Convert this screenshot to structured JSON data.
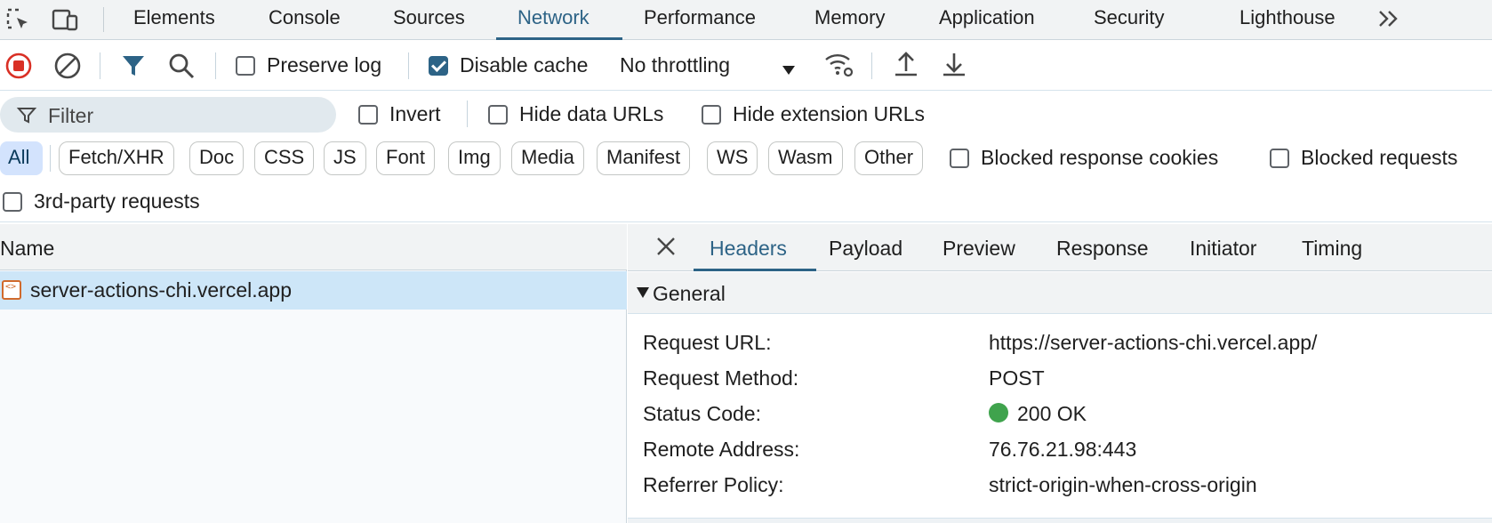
{
  "tabs": [
    {
      "label": "Elements",
      "active": false
    },
    {
      "label": "Console",
      "active": false
    },
    {
      "label": "Sources",
      "active": false
    },
    {
      "label": "Network",
      "active": true
    },
    {
      "label": "Performance",
      "active": false
    },
    {
      "label": "Memory",
      "active": false
    },
    {
      "label": "Application",
      "active": false
    },
    {
      "label": "Security",
      "active": false
    },
    {
      "label": "Lighthouse",
      "active": false
    }
  ],
  "toolbar": {
    "preserve_log": "Preserve log",
    "disable_cache": "Disable cache",
    "throttling": "No throttling"
  },
  "filter": {
    "placeholder": "Filter",
    "invert": "Invert",
    "hide_data_urls": "Hide data URLs",
    "hide_extension_urls": "Hide extension URLs"
  },
  "types": [
    "All",
    "Fetch/XHR",
    "Doc",
    "CSS",
    "JS",
    "Font",
    "Img",
    "Media",
    "Manifest",
    "WS",
    "Wasm",
    "Other"
  ],
  "extra_filters": {
    "blocked_cookies": "Blocked response cookies",
    "blocked_requests": "Blocked requests",
    "third_party": "3rd-party requests"
  },
  "requests": {
    "column_name": "Name",
    "rows": [
      {
        "name": "server-actions-chi.vercel.app"
      }
    ]
  },
  "details": {
    "tabs": [
      "Headers",
      "Payload",
      "Preview",
      "Response",
      "Initiator",
      "Timing"
    ],
    "section_title": "General",
    "general": [
      {
        "key": "Request URL:",
        "value": "https://server-actions-chi.vercel.app/"
      },
      {
        "key": "Request Method:",
        "value": "POST"
      },
      {
        "key": "Status Code:",
        "value": "200 OK"
      },
      {
        "key": "Remote Address:",
        "value": "76.76.21.98:443"
      },
      {
        "key": "Referrer Policy:",
        "value": "strict-origin-when-cross-origin"
      }
    ],
    "status_color": "#3fa34d"
  },
  "colors": {
    "accent": "#2d6386",
    "record": "#d93025"
  }
}
